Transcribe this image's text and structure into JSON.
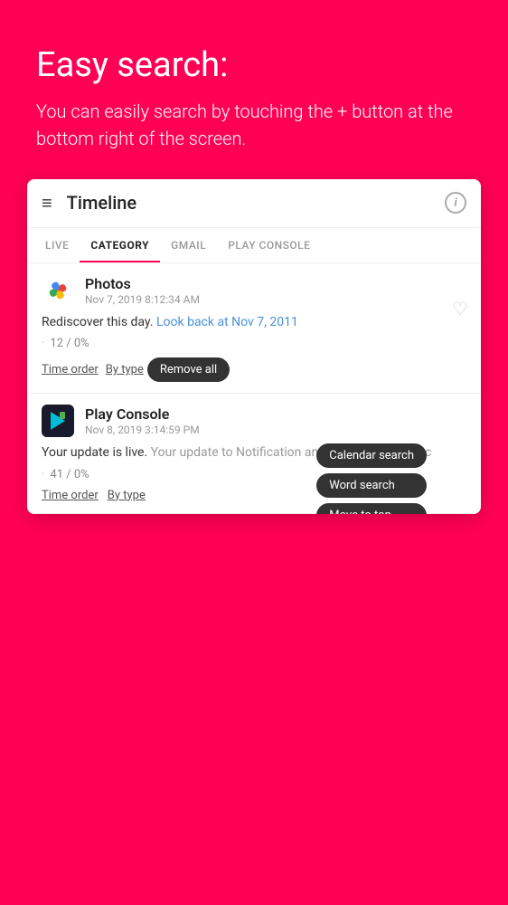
{
  "hero": {
    "title": "Easy search:",
    "subtitle": "You can easily search by touching the + button at the bottom right of the screen."
  },
  "app": {
    "title": "Timeline",
    "info_icon": "i"
  },
  "tabs": [
    {
      "label": "LIVE",
      "active": false
    },
    {
      "label": "CATEGORY",
      "active": true
    },
    {
      "label": "GMAIL",
      "active": false
    },
    {
      "label": "PLAY CONSOLE",
      "active": false
    }
  ],
  "items": [
    {
      "app_name": "Photos",
      "timestamp": "Nov 7, 2019 8:12:34 AM",
      "content_main": "Rediscover this day.",
      "content_highlight": "Look back at Nov 7, 2011",
      "stats": "12 / 0%",
      "action1": "Time order",
      "action2": "By type",
      "tooltip": "Remove all"
    },
    {
      "app_name": "Play Console",
      "timestamp": "Nov 8, 2019 3:14:59 PM",
      "content_main": "Your update is live.",
      "content_sub": "Your update to Notification announcer - ByVoice, c",
      "stats": "41 / 0%",
      "action1": "Time order",
      "action2": "By type",
      "tooltip1": "Calendar search",
      "tooltip2": "Word search",
      "tooltip3": "Move to top"
    }
  ],
  "icons": {
    "hamburger": "≡",
    "heart": "♡",
    "close": "✕",
    "trash": "🗑",
    "calendar": "📅",
    "search": "🔍",
    "arrow_up": "↑",
    "close_circle": "✕"
  }
}
